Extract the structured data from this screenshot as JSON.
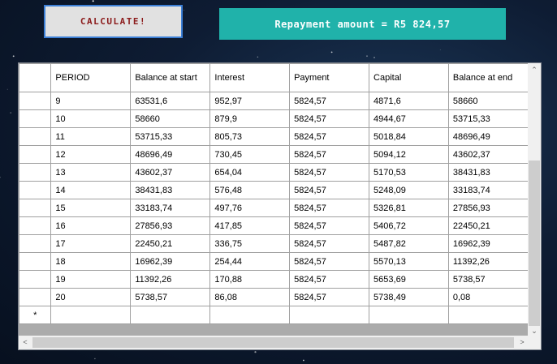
{
  "calculate_label": "CALCULATE!",
  "repayment_text": "Repayment amount = R5 824,57",
  "grid": {
    "columns": [
      "PERIOD",
      "Balance at start",
      "Interest",
      "Payment",
      "Capital",
      "Balance at end"
    ],
    "rows": [
      [
        "9",
        "63531,6",
        "952,97",
        "5824,57",
        "4871,6",
        "58660"
      ],
      [
        "10",
        "58660",
        "879,9",
        "5824,57",
        "4944,67",
        "53715,33"
      ],
      [
        "11",
        "53715,33",
        "805,73",
        "5824,57",
        "5018,84",
        "48696,49"
      ],
      [
        "12",
        "48696,49",
        "730,45",
        "5824,57",
        "5094,12",
        "43602,37"
      ],
      [
        "13",
        "43602,37",
        "654,04",
        "5824,57",
        "5170,53",
        "38431,83"
      ],
      [
        "14",
        "38431,83",
        "576,48",
        "5824,57",
        "5248,09",
        "33183,74"
      ],
      [
        "15",
        "33183,74",
        "497,76",
        "5824,57",
        "5326,81",
        "27856,93"
      ],
      [
        "16",
        "27856,93",
        "417,85",
        "5824,57",
        "5406,72",
        "22450,21"
      ],
      [
        "17",
        "22450,21",
        "336,75",
        "5824,57",
        "5487,82",
        "16962,39"
      ],
      [
        "18",
        "16962,39",
        "254,44",
        "5824,57",
        "5570,13",
        "11392,26"
      ],
      [
        "19",
        "11392,26",
        "170,88",
        "5824,57",
        "5653,69",
        "5738,57"
      ],
      [
        "20",
        "5738,57",
        "86,08",
        "5824,57",
        "5738,49",
        "0,08"
      ]
    ],
    "new_row_marker": "*"
  },
  "scrollbar": {
    "up_arrow": "⌃",
    "down_arrow": "⌄",
    "left_arrow": "<",
    "right_arrow": ">"
  }
}
